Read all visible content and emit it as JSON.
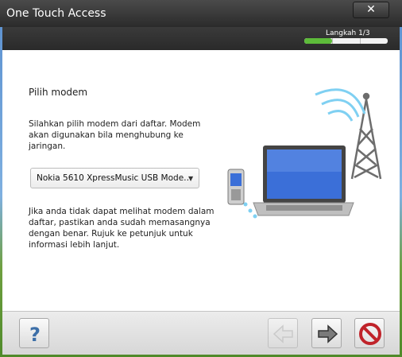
{
  "window": {
    "title": "One Touch Access",
    "close_label": "✕"
  },
  "wizard": {
    "step_label": "Langkah 1/3",
    "step_current": 1,
    "step_total": 3
  },
  "main": {
    "heading": "Pilih modem",
    "instruction": "Silahkan pilih modem dari daftar. Modem akan digunakan bila menghubung ke jaringan.",
    "modem_select_value": "Nokia 5610 XpressMusic USB Mode…",
    "help_text": "Jika anda tidak dapat melihat modem dalam daftar, pastikan anda sudah memasangnya dengan benar. Rujuk ke petunjuk untuk informasi lebih lanjut."
  },
  "footer": {
    "help_icon": "question-mark-icon",
    "help_glyph": "?",
    "back_icon": "left-arrow-icon",
    "next_icon": "right-arrow-icon",
    "cancel_icon": "prohibited-icon"
  },
  "colors": {
    "titlebar": "#2b2b2b",
    "progress_fill": "#5dbb3a",
    "help_blue": "#3d6fa8",
    "cancel_red": "#c0232a"
  }
}
